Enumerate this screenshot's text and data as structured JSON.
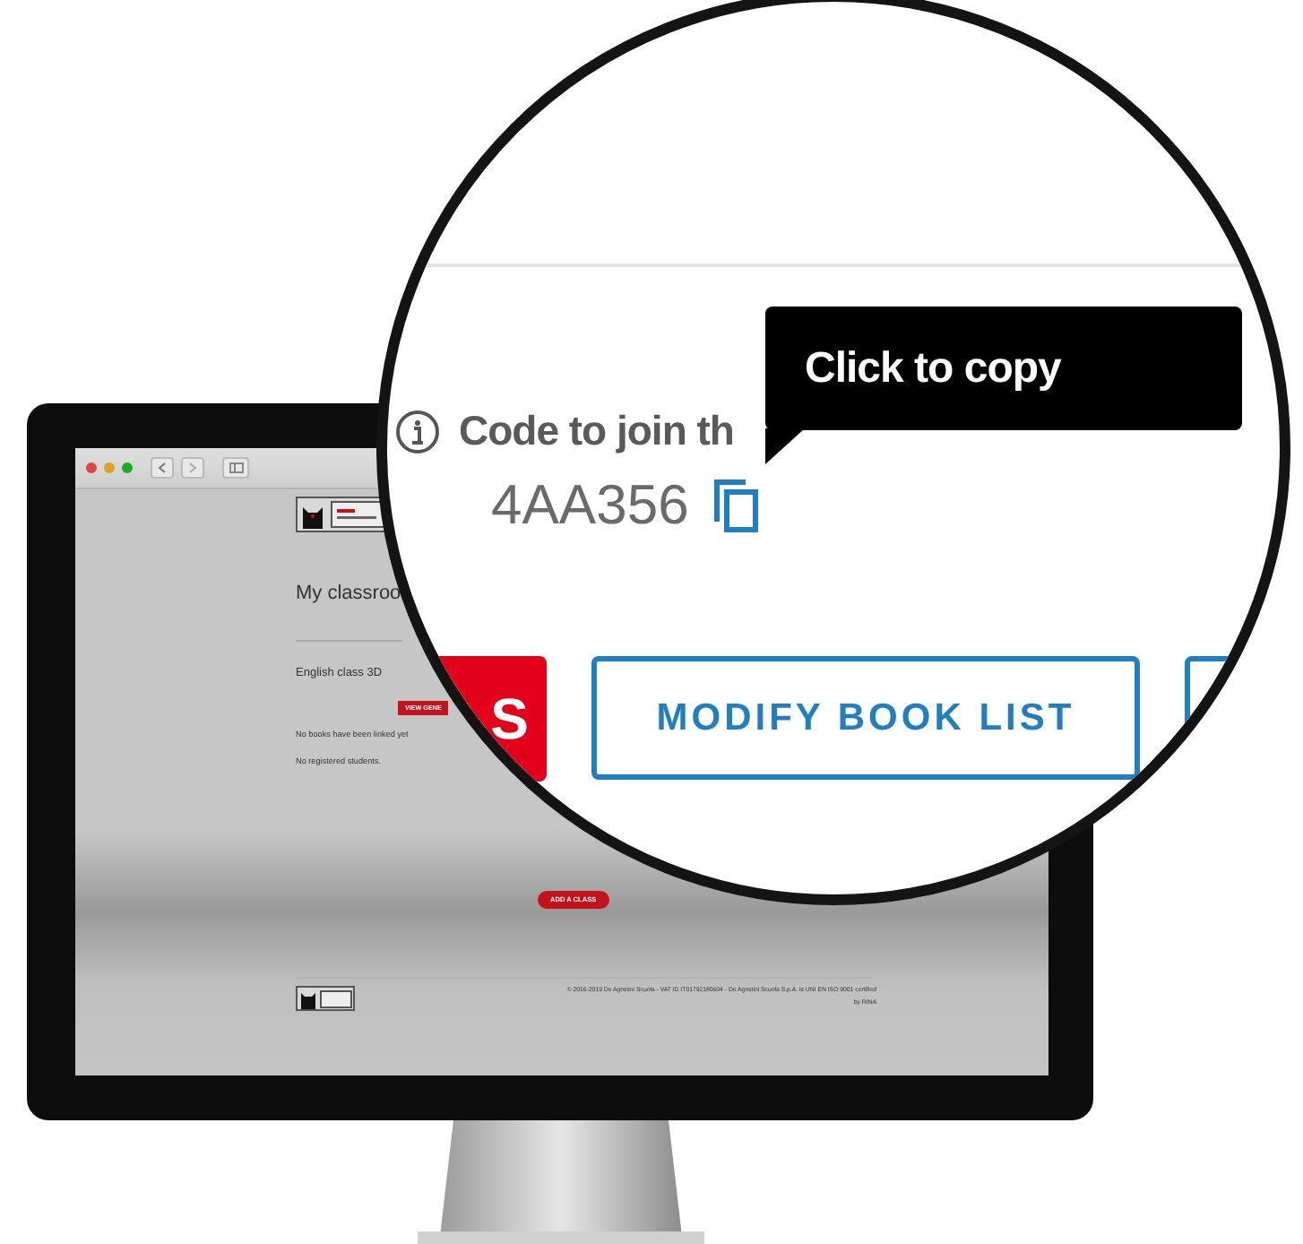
{
  "page": {
    "title": "My classroo",
    "classes": [
      {
        "name": "English class 3D",
        "button": "VIEW GENE",
        "books_note": "No books have been linked yet",
        "students_note": "No registered students."
      }
    ],
    "add_button": "ADD A CLASS",
    "footer": {
      "copyright": "© 2016-2019 De Agostini Scuola - VAT ID IT01792180604 - De Agostini Scuola S.p.A. is UNI EN ISO 9001 certified",
      "certifier": "by RINA"
    }
  },
  "magnifier": {
    "code_label": "Code to join th",
    "code": "4AA356",
    "tooltip": "Click to copy",
    "buttons": [
      {
        "label": "S",
        "kind": "filled"
      },
      {
        "label": "MODIFY BOOK LIST",
        "kind": "outlined"
      },
      {
        "kind": "outlined"
      }
    ]
  }
}
